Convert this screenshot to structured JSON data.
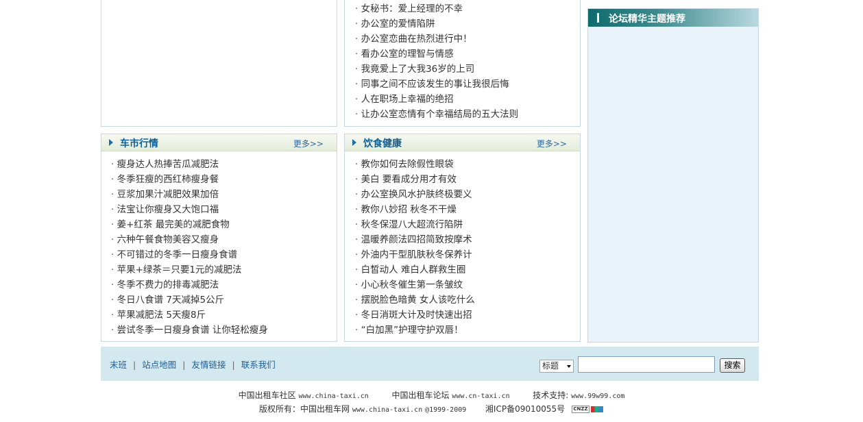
{
  "top_mid_list": [
    "女秘书：爱上经理的不幸",
    "办公室的爱情陷阱",
    "办公室恋曲在热烈进行中！",
    "看办公室的理智与情感",
    "我竟爱上了大我36岁的上司",
    "同事之间不应该发生的事让我很后悔",
    "人在职场上幸福的绝招",
    "让办公室恋情有个幸福结局的五大法则"
  ],
  "car_panel": {
    "title": "车市行情",
    "more": "更多>>",
    "items": [
      "瘦身达人热捧苦瓜减肥法",
      "冬季狂瘦的西红柿瘦身餐",
      "豆浆加果汁减肥效果加倍",
      "法宝让你瘦身又大饱口福",
      "姜+红茶 最完美的减肥食物",
      "六种午餐食物美容又瘦身",
      "不可错过的冬季一日瘦身食谱",
      "苹果+绿茶＝只要1元的减肥法",
      "冬季不费力的排毒减肥法",
      "冬日八食谱 7天减掉5公斤",
      "苹果减肥法 5天瘦8斤",
      "尝试冬季一日瘦身食谱 让你轻松瘦身"
    ]
  },
  "food_panel": {
    "title": "饮食健康",
    "more": "更多>>",
    "items": [
      "教你如何去除假性眼袋",
      "美白 要看成分用才有效",
      "办公室换风水护肤终极要义",
      "教你八妙招 秋冬不干燥",
      "秋冬保湿八大超流行陷阱",
      "温暖养颜法四招简致按摩术",
      "外油内干型肌肤秋冬保养计",
      "白皙动人 难白人群救生圈",
      "小心秋冬催生第一条皱纹",
      "摆脱脸色暗黄 女人该吃什么",
      "冬日消斑大计及时快速出招",
      "“白加黑”护理守护双唇！"
    ]
  },
  "sidebar": {
    "title": "论坛精华主题推荐"
  },
  "footer": {
    "links": [
      "末班",
      "站点地图",
      "友情链接",
      "联系我们"
    ],
    "search_select": "标题",
    "search_value": "",
    "search_button": "搜索"
  },
  "copyright": {
    "community_label": "中国出租车社区",
    "community_url": "www.china-taxi.cn",
    "forum_label": "中国出租车论坛",
    "forum_url": "www.cn-taxi.cn",
    "support_label": "技术支持:",
    "support_url": "www.99w99.com",
    "rights_label": "版权所有：中国出租车网",
    "rights_url": "www.china-taxi.cn",
    "years": "@1999-2009",
    "icp": "湘ICP备09010055号",
    "badge": "CNZZ"
  },
  "colors": {
    "accent": "#0e5f95",
    "footer_bg": "#d3e8ef",
    "sidebar_bg": "#e9f3f9"
  }
}
